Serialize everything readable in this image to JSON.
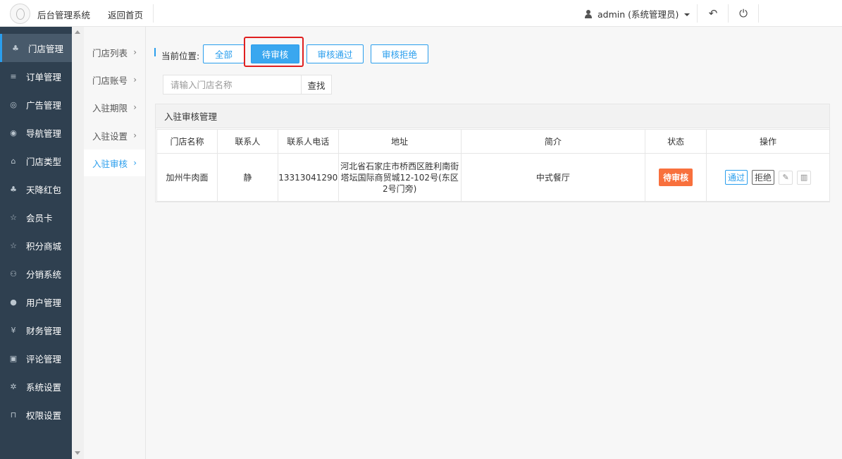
{
  "header": {
    "app_title": "后台管理系统",
    "back_home": "返回首页",
    "user": "admin (系统管理员)"
  },
  "sidebar": {
    "items": [
      {
        "label": "门店管理",
        "icon": "stores-icon"
      },
      {
        "label": "订单管理",
        "icon": "list-icon"
      },
      {
        "label": "广告管理",
        "icon": "lifebuoy-icon"
      },
      {
        "label": "导航管理",
        "icon": "compass-icon"
      },
      {
        "label": "门店类型",
        "icon": "bank-icon"
      },
      {
        "label": "天降红包",
        "icon": "stores-icon"
      },
      {
        "label": "会员卡",
        "icon": "star-icon"
      },
      {
        "label": "积分商城",
        "icon": "star-icon"
      },
      {
        "label": "分销系统",
        "icon": "users-icon"
      },
      {
        "label": "用户管理",
        "icon": "user-icon"
      },
      {
        "label": "财务管理",
        "icon": "yen-icon"
      },
      {
        "label": "评论管理",
        "icon": "money-icon"
      },
      {
        "label": "系统设置",
        "icon": "gear-icon"
      },
      {
        "label": "权限设置",
        "icon": "lock-icon"
      }
    ]
  },
  "submenu": {
    "items": [
      {
        "label": "门店列表"
      },
      {
        "label": "门店账号"
      },
      {
        "label": "入驻期限"
      },
      {
        "label": "入驻设置"
      },
      {
        "label": "入驻审核"
      }
    ]
  },
  "location": {
    "label": "当前位置:",
    "filters": [
      "全部",
      "待审核",
      "审核通过",
      "审核拒绝"
    ]
  },
  "search": {
    "placeholder": "请输入门店名称",
    "button": "查找"
  },
  "panel": {
    "title": "入驻审核管理",
    "columns": [
      "门店名称",
      "联系人",
      "联系人电话",
      "地址",
      "简介",
      "状态",
      "操作"
    ],
    "rows": [
      {
        "name": "加州牛肉面",
        "contact": "静",
        "phone": "13313041290",
        "address": "河北省石家庄市桥西区胜利南街塔坛国际商贸城12-102号(东区2号门旁)",
        "intro": "中式餐厅",
        "status": "待审核",
        "actions": {
          "pass": "通过",
          "reject": "拒绝"
        }
      }
    ]
  },
  "colors": {
    "accent": "#2a9eed",
    "sidebar_bg": "#2f4050",
    "status_badge": "#f8703d",
    "highlight": "#e02020"
  }
}
